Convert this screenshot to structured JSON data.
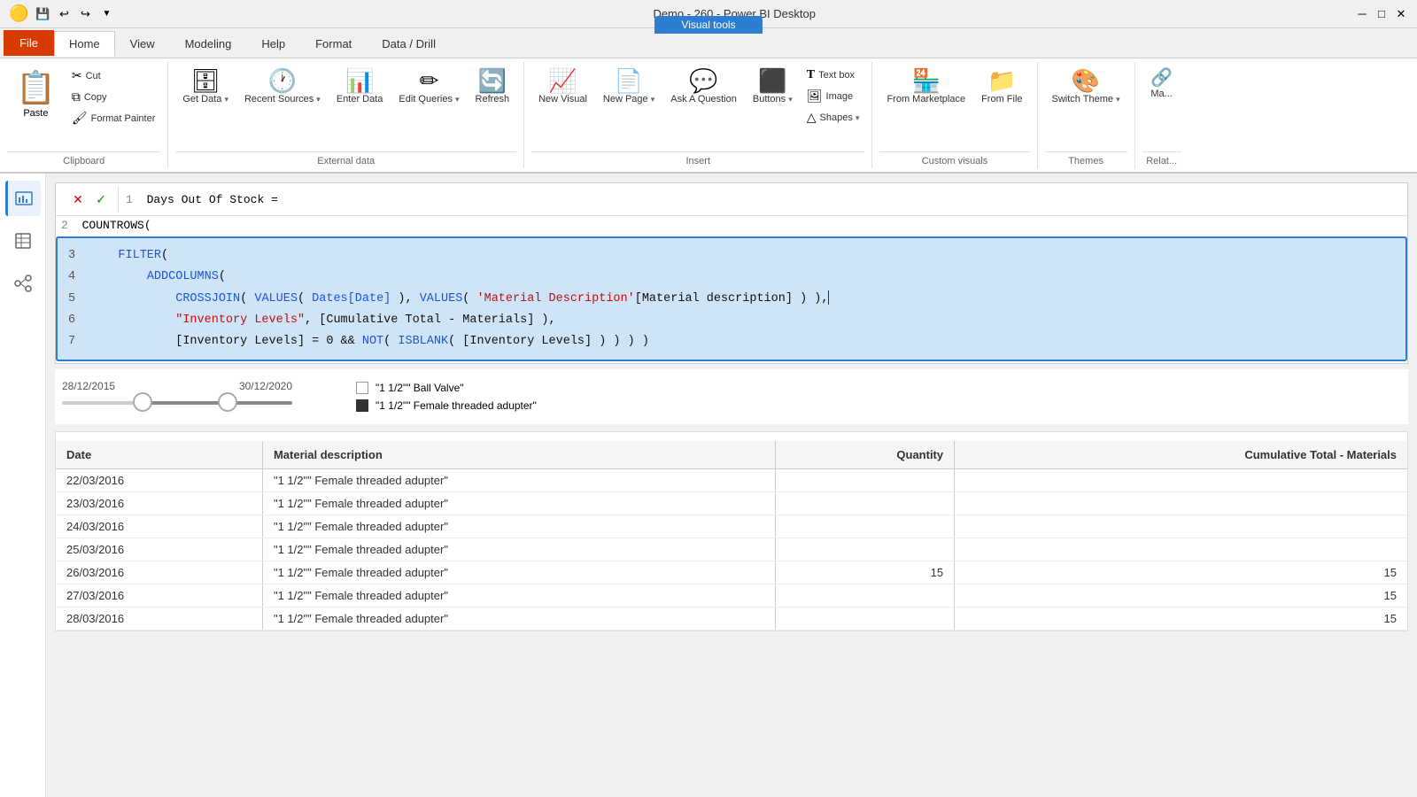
{
  "titleBar": {
    "title": "Demo - 260 - Power BI Desktop",
    "saveIcon": "💾",
    "undoIcon": "↩",
    "redoIcon": "↪"
  },
  "visualToolsBadge": "Visual tools",
  "ribbonTabs": [
    {
      "id": "file",
      "label": "File",
      "isFile": true
    },
    {
      "id": "home",
      "label": "Home",
      "active": true
    },
    {
      "id": "view",
      "label": "View"
    },
    {
      "id": "modeling",
      "label": "Modeling"
    },
    {
      "id": "help",
      "label": "Help"
    },
    {
      "id": "format",
      "label": "Format"
    },
    {
      "id": "datadrill",
      "label": "Data / Drill"
    }
  ],
  "ribbon": {
    "groups": [
      {
        "id": "clipboard",
        "label": "Clipboard",
        "items": [
          {
            "id": "paste",
            "type": "large",
            "label": "Paste",
            "icon": "📋"
          },
          {
            "id": "cut",
            "type": "small",
            "label": "Cut",
            "icon": "✂"
          },
          {
            "id": "copy",
            "type": "small",
            "label": "Copy",
            "icon": "⧉"
          },
          {
            "id": "format-painter",
            "type": "small",
            "label": "Format Painter",
            "icon": "🖌"
          }
        ]
      },
      {
        "id": "external-data",
        "label": "External data",
        "items": [
          {
            "id": "get-data",
            "type": "large",
            "label": "Get Data",
            "icon": "🗄",
            "hasDropdown": true
          },
          {
            "id": "recent-sources",
            "type": "large",
            "label": "Recent Sources",
            "icon": "🕐",
            "hasDropdown": true
          },
          {
            "id": "enter-data",
            "type": "large",
            "label": "Enter Data",
            "icon": "📊"
          },
          {
            "id": "edit-queries",
            "type": "large",
            "label": "Edit Queries",
            "icon": "✏",
            "hasDropdown": true
          },
          {
            "id": "refresh",
            "type": "large",
            "label": "Refresh",
            "icon": "🔄"
          }
        ]
      },
      {
        "id": "insert",
        "label": "Insert",
        "items": [
          {
            "id": "new-visual",
            "type": "large",
            "label": "New Visual",
            "icon": "📈"
          },
          {
            "id": "new",
            "type": "large",
            "label": "New\nPage",
            "icon": "📄",
            "hasDropdown": true
          },
          {
            "id": "ask-question",
            "type": "large",
            "label": "Ask A Question",
            "icon": "💬"
          },
          {
            "id": "buttons",
            "type": "large",
            "label": "Buttons",
            "icon": "⬛",
            "hasDropdown": true
          },
          {
            "id": "textbox",
            "type": "small",
            "label": "Text box",
            "icon": "T"
          },
          {
            "id": "image",
            "type": "small",
            "label": "Image",
            "icon": "🖼"
          },
          {
            "id": "shapes",
            "type": "small",
            "label": "Shapes",
            "icon": "△",
            "hasDropdown": true
          }
        ]
      },
      {
        "id": "custom-visuals",
        "label": "Custom visuals",
        "items": [
          {
            "id": "from-marketplace",
            "type": "large",
            "label": "From Marketplace",
            "icon": "🏪"
          },
          {
            "id": "from-file",
            "type": "large",
            "label": "From File",
            "icon": "📁"
          }
        ]
      },
      {
        "id": "themes",
        "label": "Themes",
        "items": [
          {
            "id": "switch-theme",
            "type": "large",
            "label": "Switch Theme",
            "icon": "🎨",
            "hasDropdown": true
          }
        ]
      },
      {
        "id": "relationships",
        "label": "Relat...",
        "items": [
          {
            "id": "manage-relations",
            "type": "large",
            "label": "Ma...",
            "icon": "🔗"
          }
        ]
      }
    ]
  },
  "formulaBar": {
    "closeLabel": "✕",
    "checkLabel": "✓",
    "lines": [
      {
        "num": "1",
        "text": "Days Out Of Stock ="
      },
      {
        "num": "2",
        "text": "COUNTROWS("
      }
    ],
    "selectedLines": [
      {
        "num": "3",
        "text": "    FILTER("
      },
      {
        "num": "4",
        "text": "        ADDCOLUMNS("
      },
      {
        "num": "5",
        "text": "            CROSSJOIN( VALUES( Dates[Date] ), VALUES( 'Material Description'[Material description] ) ),"
      },
      {
        "num": "6",
        "text": "            \"Inventory Levels\", [Cumulative Total - Materials] ),"
      },
      {
        "num": "7",
        "text": "            [Inventory Levels] = 0 && NOT( ISBLANK( [Inventory Levels] ) ) ) )"
      }
    ]
  },
  "dateSlider": {
    "startDate": "28/12/2015",
    "endDate": "30/12/2020"
  },
  "legend": {
    "items": [
      {
        "id": "ball-valve",
        "label": "\"1 1/2\"\" Ball Valve\"",
        "type": "checkbox"
      },
      {
        "id": "female-adapter",
        "label": "\"1 1/2\"\" Female threaded adupter\"",
        "type": "swatch",
        "color": "#333"
      }
    ]
  },
  "table": {
    "columns": [
      {
        "id": "date",
        "label": "Date"
      },
      {
        "id": "material",
        "label": "Material description"
      },
      {
        "id": "quantity",
        "label": "Quantity",
        "align": "right"
      },
      {
        "id": "cumulative",
        "label": "Cumulative Total - Materials",
        "align": "right"
      }
    ],
    "rows": [
      {
        "date": "22/03/2016",
        "material": "\"1 1/2\"\" Female threaded adupter\"",
        "quantity": "",
        "cumulative": ""
      },
      {
        "date": "23/03/2016",
        "material": "\"1 1/2\"\" Female threaded adupter\"",
        "quantity": "",
        "cumulative": ""
      },
      {
        "date": "24/03/2016",
        "material": "\"1 1/2\"\" Female threaded adupter\"",
        "quantity": "",
        "cumulative": ""
      },
      {
        "date": "25/03/2016",
        "material": "\"1 1/2\"\" Female threaded adupter\"",
        "quantity": "",
        "cumulative": ""
      },
      {
        "date": "26/03/2016",
        "material": "\"1 1/2\"\" Female threaded adupter\"",
        "quantity": "15",
        "cumulative": "15"
      },
      {
        "date": "27/03/2016",
        "material": "\"1 1/2\"\" Female threaded adupter\"",
        "quantity": "",
        "cumulative": "15"
      },
      {
        "date": "28/03/2016",
        "material": "\"1 1/2\"\" Female threaded adupter\"",
        "quantity": "",
        "cumulative": "15"
      }
    ]
  },
  "sidebar": {
    "icons": [
      {
        "id": "report",
        "icon": "📊",
        "active": true
      },
      {
        "id": "data",
        "icon": "📋",
        "active": false
      },
      {
        "id": "model",
        "icon": "🔷",
        "active": false
      }
    ]
  }
}
